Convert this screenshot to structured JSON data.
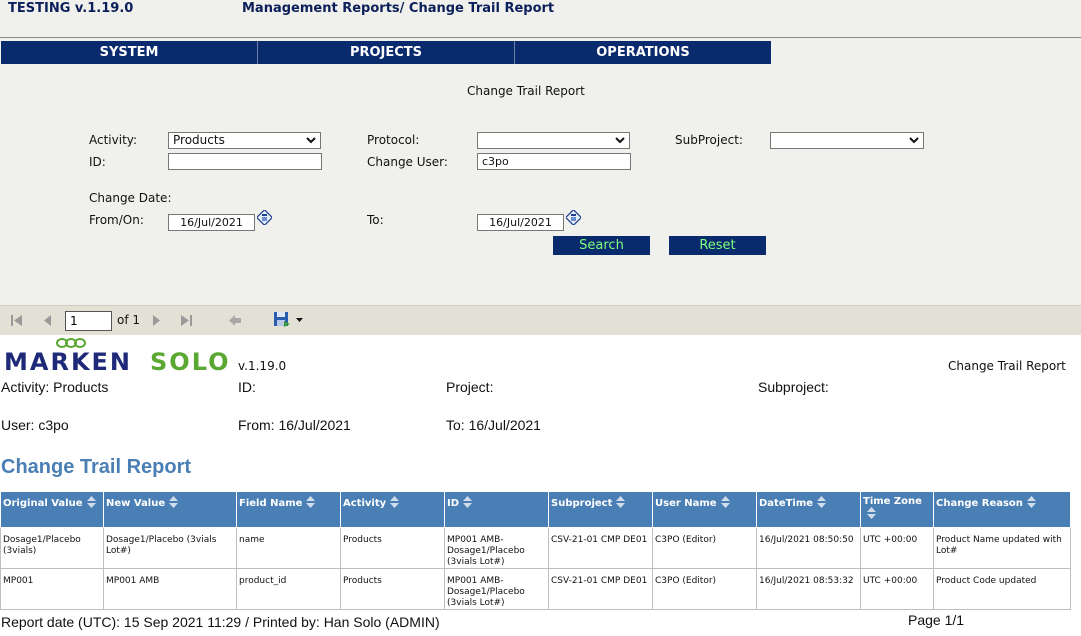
{
  "header": {
    "app_version": "TESTING v.1.19.0",
    "breadcrumb": "Management Reports/ Change Trail Report"
  },
  "nav": [
    "SYSTEM",
    "PROJECTS",
    "OPERATIONS"
  ],
  "form": {
    "title": "Change Trail Report",
    "activity_label": "Activity:",
    "activity_value": "Products",
    "protocol_label": "Protocol:",
    "protocol_value": "",
    "subproject_label": "SubProject:",
    "subproject_value": "",
    "id_label": "ID:",
    "id_value": "",
    "change_user_label": "Change User:",
    "change_user_value": "c3po",
    "change_date_label": "Change Date:",
    "from_label": "From/On:",
    "from_value": "16/Jul/2021",
    "to_label": "To:",
    "to_value": "16/Jul/2021",
    "search_label": "Search",
    "reset_label": "Reset"
  },
  "toolbar": {
    "page_value": "1",
    "of_pages": "of 1"
  },
  "report": {
    "logo_text_1": "MARKEN",
    "logo_text_2": "SOLO",
    "logo_version": "v.1.19.0",
    "title_small": "Change Trail Report",
    "meta": {
      "activity": "Activity: Products",
      "id": "ID:",
      "project": "Project:",
      "subproject": "Subproject:",
      "user": "User: c3po",
      "from": "From: 16/Jul/2021",
      "to": "To: 16/Jul/2021"
    },
    "heading": "Change Trail Report",
    "columns": [
      "Original Value",
      "New Value",
      "Field Name",
      "Activity",
      "ID",
      "Subproject",
      "User Name",
      "DateTime",
      "Time Zone",
      "Change Reason"
    ],
    "rows": [
      [
        "Dosage1/Placebo (3vials)",
        "Dosage1/Placebo (3vials Lot#)",
        "name",
        "Products",
        "MP001 AMB-Dosage1/Placebo (3vials Lot#)",
        "CSV-21-01 CMP DE01",
        "C3PO (Editor)",
        "16/Jul/2021 08:50:50",
        "UTC +00:00",
        "Product Name updated with Lot#"
      ],
      [
        "MP001",
        "MP001 AMB",
        "product_id",
        "Products",
        "MP001 AMB-Dosage1/Placebo (3vials Lot#)",
        "CSV-21-01 CMP DE01",
        "C3PO (Editor)",
        "16/Jul/2021 08:53:32",
        "UTC +00:00",
        "Product Code updated"
      ]
    ],
    "footer_left": "Report date (UTC): 15 Sep 2021 11:29 / Printed by: Han Solo (ADMIN)",
    "footer_right": "Page 1/1"
  },
  "colors": {
    "nav_bg": "#0a2a6e",
    "button_text": "#7dff7d",
    "table_header_bg": "#4a7fb5",
    "heading_blue": "#4a7fb5",
    "logo_blue": "#1e2a78",
    "logo_green": "#5aa832"
  },
  "icons": [
    "first-page-icon",
    "prev-page-icon",
    "next-page-icon",
    "last-page-icon",
    "back-icon",
    "export-save-icon",
    "calendar-icon",
    "sort-icon",
    "chevron-down-icon"
  ]
}
